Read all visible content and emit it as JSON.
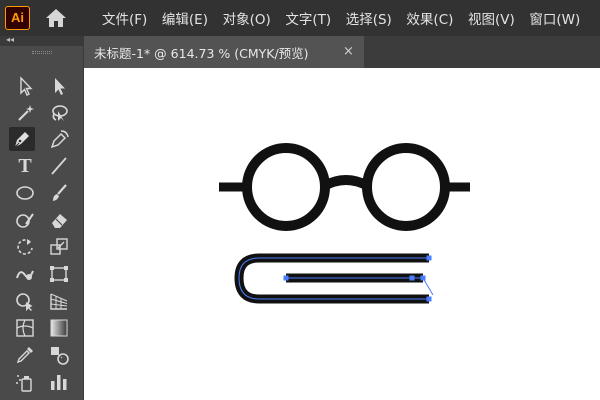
{
  "app": {
    "logo_text": "Ai",
    "logo_color": "#ff9a00",
    "home_icon": "home-icon"
  },
  "menu": [
    "文件(F)",
    "编辑(E)",
    "对象(O)",
    "文字(T)",
    "选择(S)",
    "效果(C)",
    "视图(V)",
    "窗口(W)"
  ],
  "document_tab": {
    "label": "未标题-1* @ 614.73 % (CMYK/预览)",
    "close_label": "×"
  },
  "toolbar": {
    "collapse_label": "◂◂",
    "tools": [
      "selection-tool-icon",
      "direct-selection-tool-icon",
      "magic-wand-tool-icon",
      "lasso-tool-icon",
      "pen-tool-icon",
      "curvature-tool-icon",
      "type-tool-icon",
      "line-segment-tool-icon",
      "ellipse-tool-icon",
      "paintbrush-tool-icon",
      "shaper-tool-icon",
      "eraser-tool-icon",
      "rotate-tool-icon",
      "scale-tool-icon",
      "warp-tool-icon",
      "free-transform-tool-icon",
      "shape-builder-tool-icon",
      "perspective-grid-tool-icon",
      "mesh-tool-icon",
      "gradient-tool-icon",
      "eyedropper-tool-icon",
      "blend-tool-icon",
      "symbol-sprayer-tool-icon",
      "column-graph-tool-icon"
    ],
    "type_tool_glyph": "T",
    "active_tool": "pen-tool-icon"
  },
  "colors": {
    "selection": "#4d7dff",
    "artwork": "#111111",
    "toolbar_bg": "#4a4a4a"
  }
}
